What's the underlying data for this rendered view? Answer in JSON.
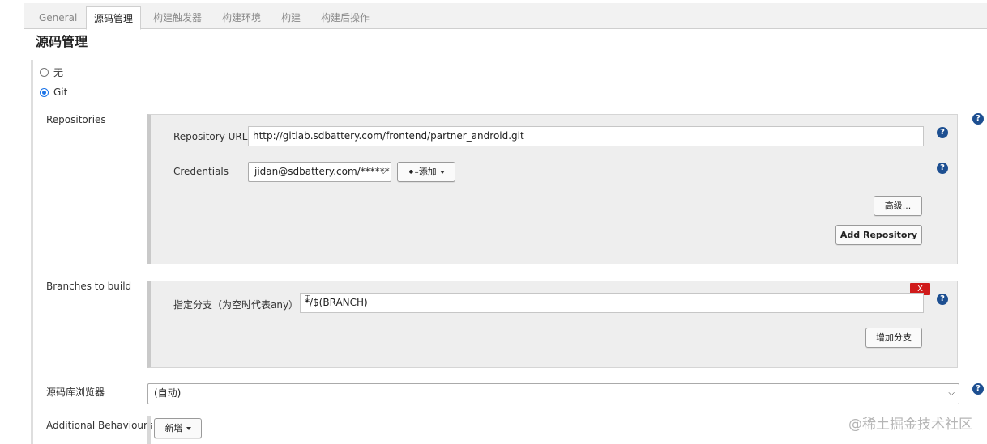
{
  "tabs": [
    {
      "label": "General"
    },
    {
      "label": "源码管理"
    },
    {
      "label": "构建触发器"
    },
    {
      "label": "构建环境"
    },
    {
      "label": "构建"
    },
    {
      "label": "构建后操作"
    }
  ],
  "section_title": "源码管理",
  "scm_options": [
    {
      "label": "无",
      "checked": false
    },
    {
      "label": "Git",
      "checked": true
    }
  ],
  "repositories": {
    "label": "Repositories",
    "url_label": "Repository URL",
    "url_value": "http://gitlab.sdbattery.com/frontend/partner_android.git",
    "credentials_label": "Credentials",
    "credentials_value": "jidan@sdbattery.com/******",
    "add_credentials_label": "添加",
    "advanced_label": "高级...",
    "add_repository_label": "Add Repository"
  },
  "branches": {
    "label": "Branches to build",
    "specifier_label": "指定分支（为空时代表any）",
    "specifier_value": "*/$(BRANCH)",
    "delete_label": "X",
    "add_branch_label": "增加分支"
  },
  "repo_browser": {
    "label": "源码库浏览器",
    "value": "(自动)"
  },
  "additional_behaviours": {
    "label": "Additional Behaviours",
    "add_label": "新增"
  },
  "help_glyph": "?",
  "watermark": "@稀土掘金技术社区",
  "colors": {
    "help_icon": "#1d4f91",
    "delete_button": "#d01b1b",
    "radio_selected": "#1a73e8",
    "panel_bg": "#eeeeee"
  }
}
